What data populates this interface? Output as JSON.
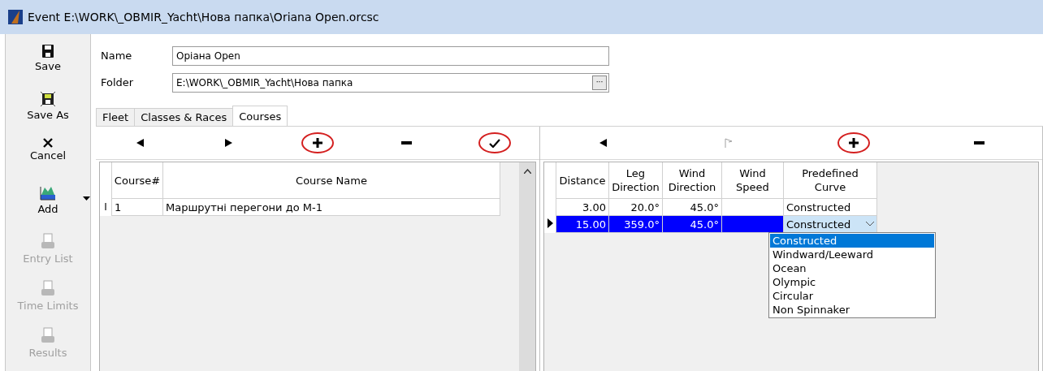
{
  "window": {
    "title": "Event E:\\WORK\\_OBMIR_Yacht\\Нова папка\\Oriana Open.orcsc"
  },
  "sidebar": {
    "items": [
      {
        "kind": "save",
        "label": "Save",
        "disabled": false,
        "dropdown": false
      },
      {
        "kind": "save_as",
        "label": "Save As",
        "disabled": false,
        "dropdown": false
      },
      {
        "kind": "cancel",
        "label": "Cancel",
        "disabled": false,
        "dropdown": false
      },
      {
        "kind": "add",
        "label": "Add",
        "disabled": false,
        "dropdown": true
      },
      {
        "kind": "print",
        "label": "Entry List",
        "disabled": true,
        "dropdown": false
      },
      {
        "kind": "print",
        "label": "Time Limits",
        "disabled": true,
        "dropdown": false
      },
      {
        "kind": "print",
        "label": "Results",
        "disabled": true,
        "dropdown": false
      }
    ]
  },
  "form": {
    "name": {
      "label": "Name",
      "value": "Оріана Open"
    },
    "folder": {
      "label": "Folder",
      "value": "E:\\WORK\\_OBMIR_Yacht\\Нова папка",
      "browse": "···"
    }
  },
  "tabs": [
    {
      "label": "Fleet",
      "selected": false
    },
    {
      "label": "Classes & Races",
      "selected": false
    },
    {
      "label": "Courses",
      "selected": true
    }
  ],
  "courses": {
    "toolbar": [
      {
        "kind": "prev",
        "disabled": false,
        "circled": false
      },
      {
        "kind": "next",
        "disabled": false,
        "circled": false
      },
      {
        "kind": "add",
        "disabled": false,
        "circled": true
      },
      {
        "kind": "remove",
        "disabled": false,
        "circled": false
      },
      {
        "kind": "apply",
        "disabled": false,
        "circled": true
      }
    ],
    "columns": [
      "Course#",
      "Course Name"
    ],
    "rows": [
      {
        "cursor": "I",
        "cells": [
          "1",
          "Маршрутні перегони до М-1"
        ],
        "selected": false
      }
    ]
  },
  "legs": {
    "toolbar": [
      {
        "kind": "prev",
        "disabled": false,
        "circled": false
      },
      {
        "kind": "flag",
        "disabled": true,
        "circled": false
      },
      {
        "kind": "add",
        "disabled": false,
        "circled": true
      },
      {
        "kind": "remove",
        "disabled": false,
        "circled": false
      }
    ],
    "columns": [
      "Distance",
      "Leg Direction",
      "Wind Direction",
      "Wind Speed",
      "Predefined Curve"
    ],
    "rows": [
      {
        "cells": [
          "3.00",
          "20.0°",
          "45.0°",
          "",
          "Constructed"
        ],
        "selected": false
      },
      {
        "cells": [
          "15.00",
          "359.0°",
          "45.0°",
          "",
          "Constructed"
        ],
        "selected": true
      }
    ],
    "dropdown": [
      {
        "label": "Constructed",
        "selected": true
      },
      {
        "label": "Windward/Leeward",
        "selected": false
      },
      {
        "label": "Ocean",
        "selected": false
      },
      {
        "label": "Olympic",
        "selected": false
      },
      {
        "label": "Circular",
        "selected": false
      },
      {
        "label": "Non Spinnaker",
        "selected": false
      }
    ]
  }
}
